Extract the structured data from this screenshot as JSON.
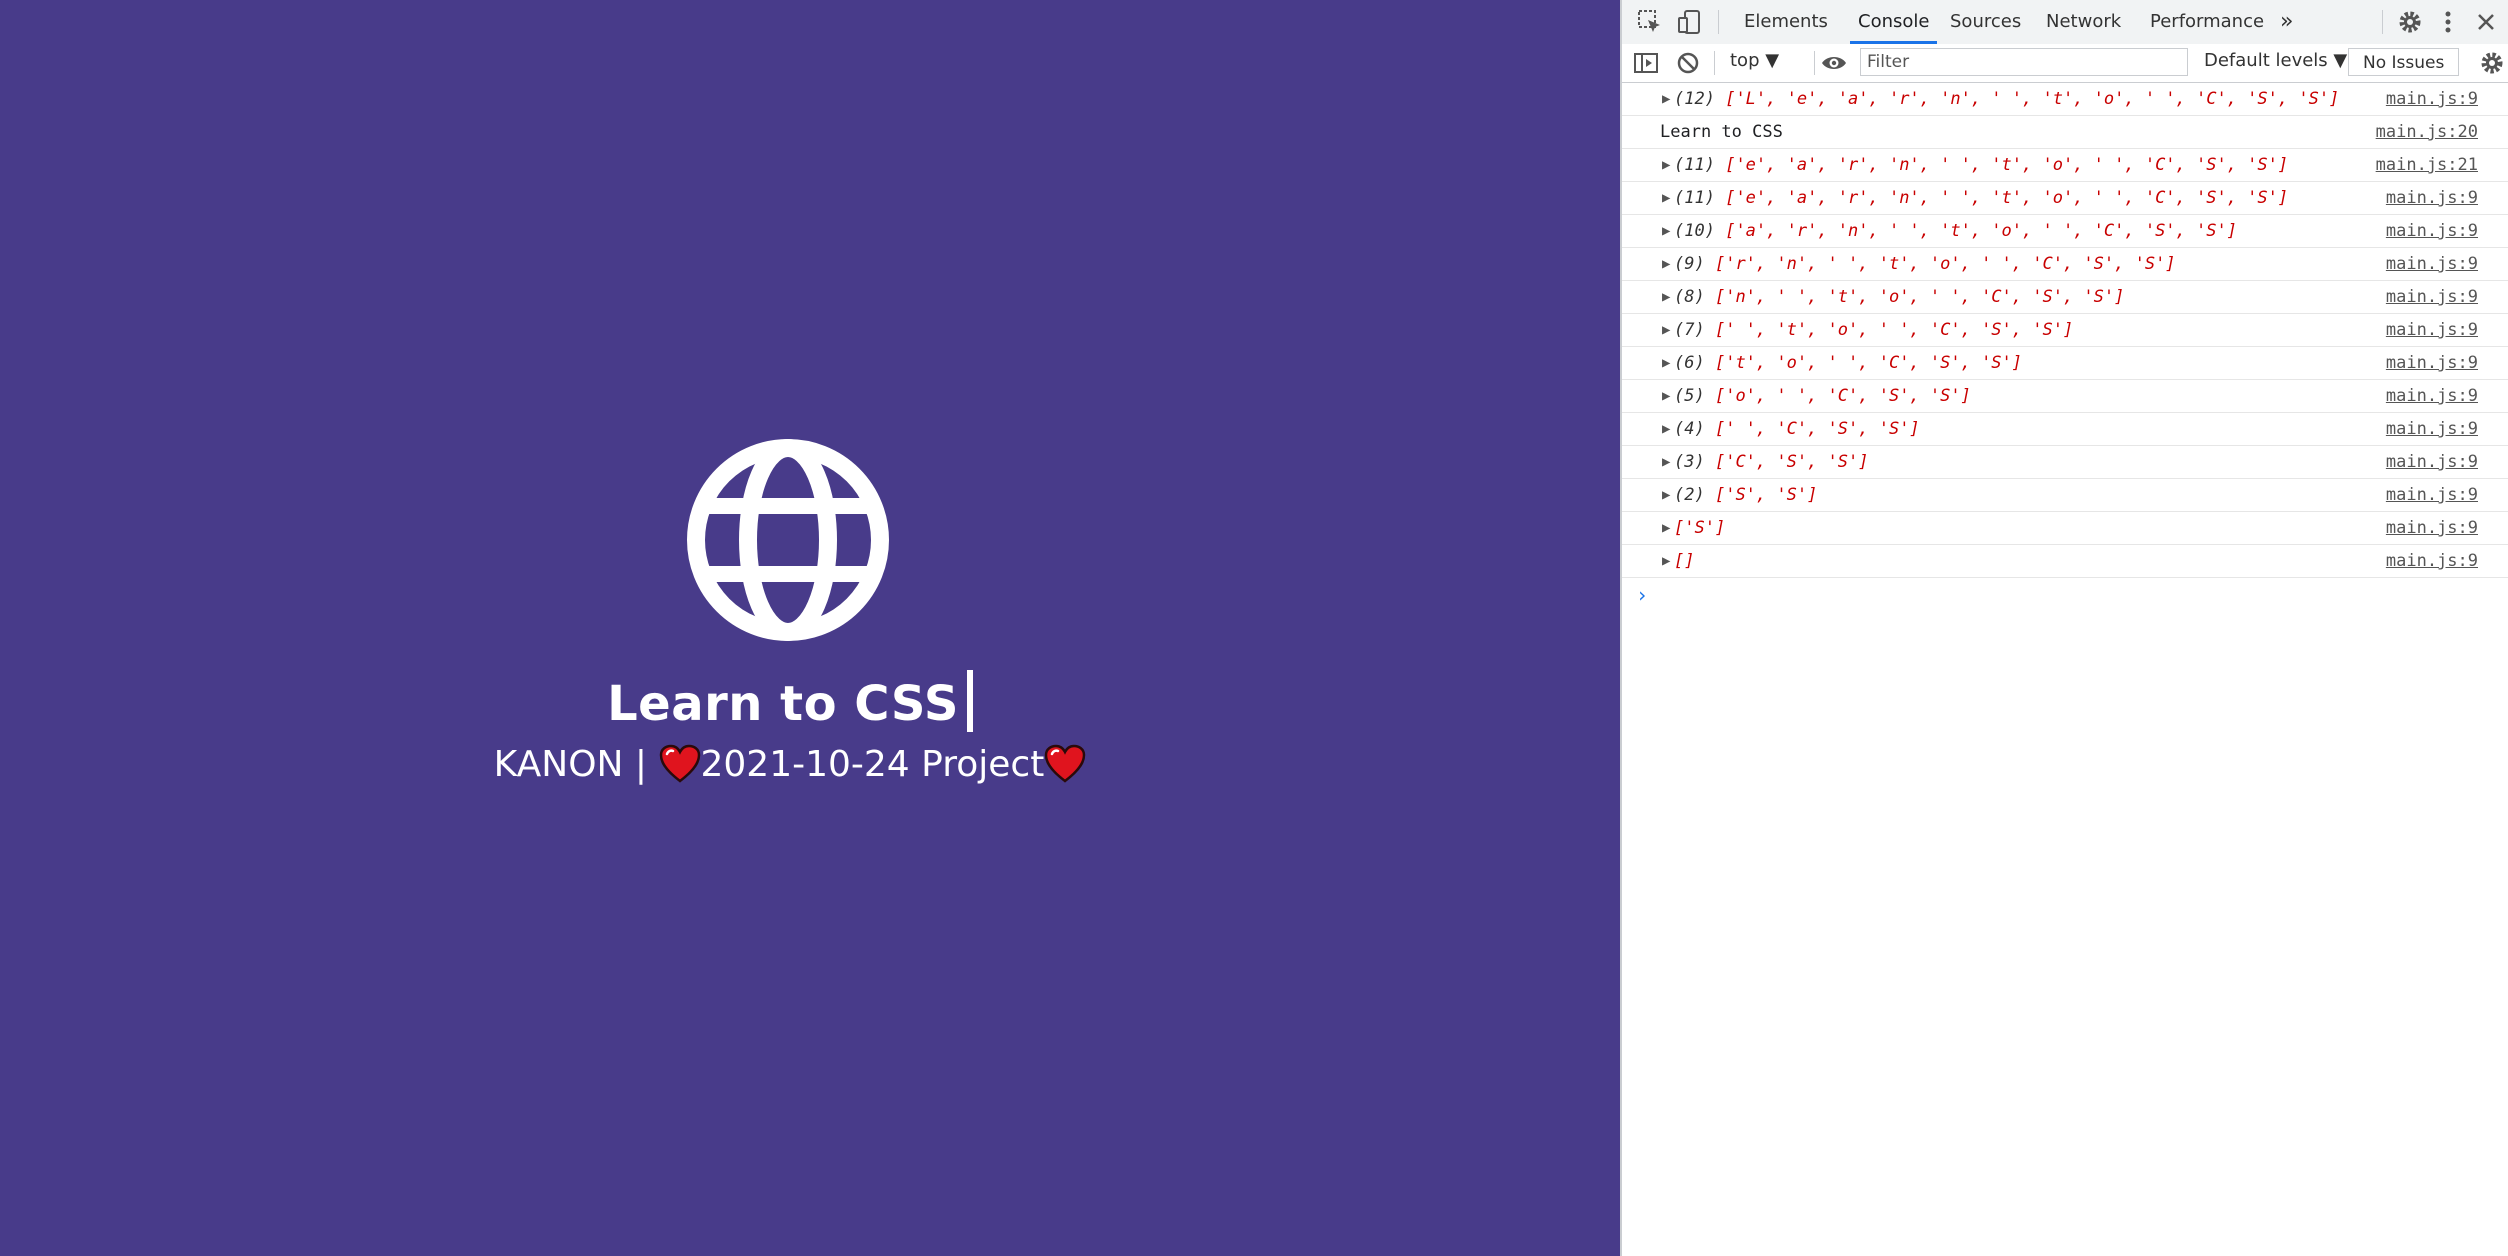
{
  "page": {
    "background": "#483b8a",
    "icon": "globe-icon",
    "title": "Learn to CSS",
    "subtitle_author": "KANON |",
    "subtitle_project": "2021-10-24 Project",
    "heart_icon": "heart-icon"
  },
  "devtools": {
    "tabs": [
      "Elements",
      "Console",
      "Sources",
      "Network",
      "Performance"
    ],
    "active_tab": "Console",
    "more_tabs": "»",
    "toolbar": {
      "context": "top ▼",
      "filter_placeholder": "Filter",
      "levels": "Default levels ▼",
      "issues": "No Issues"
    },
    "console_rows": [
      {
        "count": "(12)",
        "array": "['L', 'e', 'a', 'r', 'n', ' ', 't', 'o', ' ', 'C', 'S', 'S']",
        "source": "main.js:9"
      },
      {
        "text": "Learn to CSS",
        "source": "main.js:20"
      },
      {
        "count": "(11)",
        "array": "['e', 'a', 'r', 'n', ' ', 't', 'o', ' ', 'C', 'S', 'S']",
        "source": "main.js:21"
      },
      {
        "count": "(11)",
        "array": "['e', 'a', 'r', 'n', ' ', 't', 'o', ' ', 'C', 'S', 'S']",
        "source": "main.js:9"
      },
      {
        "count": "(10)",
        "array": "['a', 'r', 'n', ' ', 't', 'o', ' ', 'C', 'S', 'S']",
        "source": "main.js:9"
      },
      {
        "count": "(9)",
        "array": "['r', 'n', ' ', 't', 'o', ' ', 'C', 'S', 'S']",
        "source": "main.js:9"
      },
      {
        "count": "(8)",
        "array": "['n', ' ', 't', 'o', ' ', 'C', 'S', 'S']",
        "source": "main.js:9"
      },
      {
        "count": "(7)",
        "array": "[' ', 't', 'o', ' ', 'C', 'S', 'S']",
        "source": "main.js:9"
      },
      {
        "count": "(6)",
        "array": "['t', 'o', ' ', 'C', 'S', 'S']",
        "source": "main.js:9"
      },
      {
        "count": "(5)",
        "array": "['o', ' ', 'C', 'S', 'S']",
        "source": "main.js:9"
      },
      {
        "count": "(4)",
        "array": "[' ', 'C', 'S', 'S']",
        "source": "main.js:9"
      },
      {
        "count": "(3)",
        "array": "['C', 'S', 'S']",
        "source": "main.js:9"
      },
      {
        "count": "(2)",
        "array": "['S', 'S']",
        "source": "main.js:9"
      },
      {
        "count": "",
        "array": "['S']",
        "source": "main.js:9"
      },
      {
        "count": "",
        "array": "[]",
        "source": "main.js:9"
      }
    ],
    "prompt": "›"
  }
}
